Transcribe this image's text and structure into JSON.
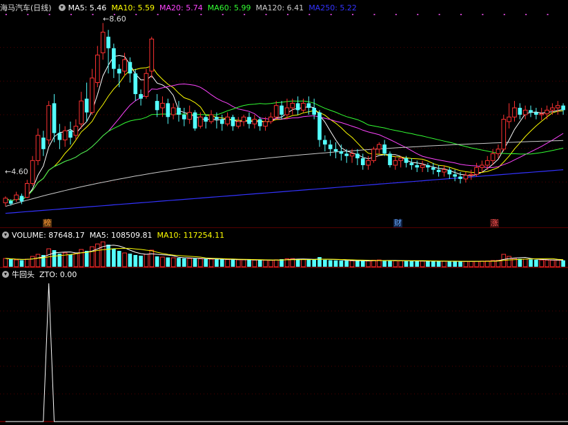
{
  "header": {
    "title": "海马汽车(日线)",
    "ma5": "MA5: 5.46",
    "ma10": "MA10: 5.59",
    "ma20": "MA20: 5.74",
    "ma60": "MA60: 5.99",
    "ma120": "MA120: 6.41",
    "ma250": "MA250: 5.22",
    "colors": {
      "ma5": "#ffffff",
      "ma10": "#ffff00",
      "ma20": "#ff44ff",
      "ma60": "#33ff33",
      "ma120": "#cccccc",
      "ma250": "#3333ff"
    }
  },
  "price_labels": {
    "high": "8.60",
    "low": "4.60"
  },
  "event_tags": [
    {
      "text": "榜",
      "color": "#ff9933"
    },
    {
      "text": "财",
      "color": "#66aaff"
    },
    {
      "text": "涨",
      "color": "#ff5555"
    }
  ],
  "volume_header": {
    "label": "VOLUME: 87648.17",
    "ma5": "MA5: 108509.81",
    "ma10": "MA10: 117254.11"
  },
  "indicator_header": {
    "name": "牛回头",
    "value": "ZTO: 0.00"
  },
  "chart_data": [
    {
      "type": "candlestick",
      "title": "海马汽车(日线)",
      "ylim": [
        4.4,
        8.8
      ],
      "high_label": 8.6,
      "low_label": 4.6,
      "candles": [
        [
          4.68,
          4.78,
          4.6,
          4.82
        ],
        [
          4.72,
          4.66,
          4.62,
          4.76
        ],
        [
          4.75,
          4.85,
          4.7,
          4.92
        ],
        [
          4.83,
          4.71,
          4.65,
          4.88
        ],
        [
          4.8,
          5.1,
          4.78,
          5.18
        ],
        [
          5.1,
          5.6,
          5.05,
          5.7
        ],
        [
          5.6,
          6.15,
          5.5,
          6.3
        ],
        [
          6.1,
          5.85,
          5.7,
          6.25
        ],
        [
          6.05,
          6.8,
          5.95,
          6.9
        ],
        [
          6.85,
          6.2,
          6.0,
          7.05
        ],
        [
          6.2,
          6.05,
          5.85,
          6.4
        ],
        [
          6.05,
          6.25,
          5.9,
          6.35
        ],
        [
          6.25,
          6.1,
          5.95,
          6.45
        ],
        [
          6.15,
          6.35,
          6.05,
          6.5
        ],
        [
          6.4,
          6.9,
          6.3,
          7.1
        ],
        [
          6.95,
          6.65,
          6.45,
          7.3
        ],
        [
          6.65,
          7.4,
          6.6,
          7.6
        ],
        [
          7.3,
          7.9,
          7.2,
          8.1
        ],
        [
          7.95,
          8.4,
          7.8,
          8.6
        ],
        [
          8.3,
          8.05,
          7.5,
          8.45
        ],
        [
          8.05,
          7.6,
          7.4,
          8.15
        ],
        [
          7.6,
          7.5,
          7.2,
          7.7
        ],
        [
          7.55,
          7.8,
          7.45,
          7.95
        ],
        [
          7.75,
          7.5,
          7.3,
          7.85
        ],
        [
          7.5,
          7.05,
          6.9,
          7.6
        ],
        [
          7.05,
          6.95,
          6.8,
          7.15
        ],
        [
          7.0,
          7.5,
          6.95,
          7.6
        ],
        [
          7.55,
          8.25,
          7.4,
          8.3
        ],
        [
          6.9,
          6.7,
          6.55,
          7.05
        ],
        [
          6.75,
          6.85,
          6.55,
          7.0
        ],
        [
          6.85,
          6.55,
          6.4,
          6.95
        ],
        [
          6.6,
          6.75,
          6.5,
          6.85
        ],
        [
          6.75,
          6.6,
          6.45,
          6.9
        ],
        [
          6.6,
          6.5,
          6.35,
          6.75
        ],
        [
          6.5,
          6.65,
          6.4,
          6.8
        ],
        [
          6.65,
          6.3,
          6.25,
          6.7
        ],
        [
          6.35,
          6.55,
          6.3,
          6.65
        ],
        [
          6.55,
          6.45,
          6.3,
          6.6
        ],
        [
          6.45,
          6.6,
          6.4,
          6.7
        ],
        [
          6.55,
          6.5,
          6.3,
          6.65
        ],
        [
          6.5,
          6.4,
          6.25,
          6.6
        ],
        [
          6.4,
          6.55,
          6.35,
          6.65
        ],
        [
          6.55,
          6.35,
          6.25,
          6.6
        ],
        [
          6.35,
          6.45,
          6.3,
          6.55
        ],
        [
          6.45,
          6.55,
          6.35,
          6.6
        ],
        [
          6.55,
          6.4,
          6.3,
          6.65
        ],
        [
          6.4,
          6.5,
          6.3,
          6.6
        ],
        [
          6.5,
          6.35,
          6.25,
          6.55
        ],
        [
          6.35,
          6.45,
          6.25,
          6.55
        ],
        [
          6.45,
          6.55,
          6.4,
          6.65
        ],
        [
          6.55,
          6.8,
          6.5,
          6.9
        ],
        [
          6.8,
          6.6,
          6.5,
          6.9
        ],
        [
          6.6,
          6.75,
          6.5,
          6.95
        ],
        [
          6.75,
          6.85,
          6.6,
          6.95
        ],
        [
          6.85,
          6.7,
          6.6,
          7.0
        ],
        [
          6.7,
          6.85,
          6.65,
          6.95
        ],
        [
          6.85,
          6.75,
          6.6,
          7.0
        ],
        [
          6.75,
          6.6,
          6.5,
          6.95
        ],
        [
          6.65,
          6.05,
          5.9,
          6.7
        ],
        [
          6.05,
          5.95,
          5.8,
          6.15
        ],
        [
          5.95,
          5.85,
          5.7,
          6.05
        ],
        [
          5.85,
          5.8,
          5.65,
          6.0
        ],
        [
          5.8,
          5.75,
          5.6,
          5.95
        ],
        [
          5.75,
          5.7,
          5.55,
          5.85
        ],
        [
          5.7,
          5.75,
          5.55,
          5.85
        ],
        [
          5.75,
          5.65,
          5.5,
          5.85
        ],
        [
          5.65,
          5.5,
          5.4,
          5.75
        ],
        [
          5.5,
          5.6,
          5.4,
          5.7
        ],
        [
          5.6,
          5.85,
          5.55,
          5.9
        ],
        [
          5.85,
          5.95,
          5.75,
          6.0
        ],
        [
          5.95,
          5.75,
          5.7,
          6.05
        ],
        [
          5.75,
          5.5,
          5.45,
          5.8
        ],
        [
          5.5,
          5.6,
          5.4,
          5.7
        ],
        [
          5.6,
          5.65,
          5.45,
          5.7
        ],
        [
          5.65,
          5.55,
          5.45,
          5.7
        ],
        [
          5.55,
          5.5,
          5.4,
          5.65
        ],
        [
          5.5,
          5.45,
          5.35,
          5.6
        ],
        [
          5.45,
          5.5,
          5.35,
          5.6
        ],
        [
          5.5,
          5.45,
          5.35,
          5.55
        ],
        [
          5.45,
          5.4,
          5.3,
          5.55
        ],
        [
          5.4,
          5.35,
          5.25,
          5.5
        ],
        [
          5.35,
          5.4,
          5.25,
          5.5
        ],
        [
          5.4,
          5.3,
          5.2,
          5.45
        ],
        [
          5.3,
          5.25,
          5.15,
          5.4
        ],
        [
          5.25,
          5.2,
          5.1,
          5.35
        ],
        [
          5.2,
          5.28,
          5.12,
          5.35
        ],
        [
          5.28,
          5.3,
          5.18,
          5.4
        ],
        [
          5.3,
          5.45,
          5.25,
          5.55
        ],
        [
          5.45,
          5.5,
          5.35,
          5.6
        ],
        [
          5.5,
          5.6,
          5.4,
          5.7
        ],
        [
          5.6,
          5.75,
          5.5,
          5.85
        ],
        [
          5.75,
          5.85,
          5.65,
          5.95
        ],
        [
          5.85,
          6.5,
          5.8,
          6.6
        ],
        [
          6.45,
          6.55,
          6.3,
          6.85
        ],
        [
          6.55,
          6.75,
          6.45,
          6.9
        ],
        [
          6.75,
          6.6,
          6.5,
          6.85
        ],
        [
          6.6,
          6.7,
          6.5,
          6.8
        ],
        [
          6.7,
          6.65,
          6.55,
          6.8
        ],
        [
          6.65,
          6.6,
          6.5,
          6.75
        ],
        [
          6.6,
          6.62,
          6.48,
          6.75
        ],
        [
          6.62,
          6.7,
          6.5,
          6.8
        ],
        [
          6.7,
          6.75,
          6.6,
          6.85
        ],
        [
          6.75,
          6.8,
          6.6,
          6.9
        ],
        [
          6.8,
          6.7,
          6.6,
          6.85
        ]
      ]
    },
    {
      "type": "bar",
      "title": "VOLUME",
      "series": [
        {
          "name": "VOLUME",
          "values": [
            120,
            110,
            100,
            95,
            110,
            150,
            180,
            170,
            260,
            240,
            190,
            200,
            180,
            190,
            250,
            230,
            290,
            330,
            360,
            320,
            260,
            230,
            200,
            190,
            170,
            160,
            180,
            240,
            150,
            140,
            135,
            130,
            128,
            122,
            120,
            118,
            115,
            112,
            110,
            108,
            106,
            104,
            102,
            100,
            100,
            98,
            96,
            95,
            94,
            93,
            100,
            110,
            115,
            118,
            110,
            105,
            102,
            100,
            140,
            100,
            95,
            92,
            90,
            88,
            86,
            85,
            84,
            83,
            95,
            98,
            90,
            88,
            86,
            85,
            84,
            83,
            82,
            82,
            81,
            80,
            80,
            79,
            78,
            78,
            77,
            77,
            78,
            80,
            82,
            84,
            90,
            92,
            180,
            150,
            120,
            115,
            110,
            105,
            100,
            98,
            96,
            95,
            94,
            93
          ]
        }
      ],
      "ma5": 108509.81,
      "ma10": 117254.11
    },
    {
      "type": "line",
      "title": "牛回头",
      "series": [
        {
          "name": "ZTO",
          "values": [
            0,
            0,
            0,
            0,
            0,
            0,
            0,
            0,
            0,
            0,
            0,
            0,
            0,
            0,
            0,
            0,
            0,
            0,
            0,
            0,
            0,
            0,
            0,
            0,
            0,
            0,
            0,
            0,
            0,
            0,
            0,
            0,
            0,
            0,
            0,
            0,
            0,
            0,
            0,
            0,
            0,
            0,
            0,
            0,
            0,
            0,
            0,
            0,
            0,
            0,
            0,
            0,
            0,
            0,
            0,
            0,
            0,
            0,
            0,
            0,
            0,
            0,
            0,
            0,
            0,
            0,
            0,
            0,
            0,
            0,
            0,
            0,
            0,
            0,
            0,
            0,
            0,
            0,
            0,
            0,
            0,
            0,
            0,
            0,
            0,
            0,
            0,
            0,
            0,
            0,
            0,
            0,
            0,
            0,
            0,
            0,
            0,
            0,
            0,
            0,
            0,
            0,
            0,
            0,
            0
          ]
        }
      ],
      "spikes": [
        {
          "index": 8,
          "value": 1
        }
      ]
    }
  ]
}
